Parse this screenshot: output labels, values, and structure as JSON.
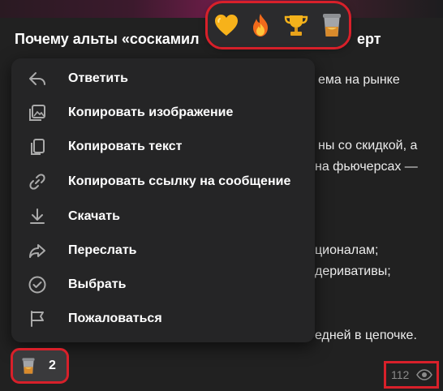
{
  "message": {
    "title_start": "Почему альты «соскамил",
    "title_end": "ерт",
    "lines": [
      "ема на рынке",
      "ны со скидкой, а",
      "на фьючерсах —",
      "ционалам;",
      "деривативы;",
      "едней в цепочке."
    ]
  },
  "reactions_bar": {
    "items": [
      {
        "name": "heart",
        "label": "💛"
      },
      {
        "name": "fire",
        "label": "🔥"
      },
      {
        "name": "trophy",
        "label": "🏆"
      },
      {
        "name": "trash",
        "label": "🗑"
      }
    ]
  },
  "context_menu": {
    "items": [
      {
        "label": "Ответить",
        "icon": "reply-icon"
      },
      {
        "label": "Копировать изображение",
        "icon": "copy-image-icon"
      },
      {
        "label": "Копировать текст",
        "icon": "copy-text-icon"
      },
      {
        "label": "Копировать ссылку на сообщение",
        "icon": "link-icon"
      },
      {
        "label": "Скачать",
        "icon": "download-icon"
      },
      {
        "label": "Переслать",
        "icon": "forward-icon"
      },
      {
        "label": "Выбрать",
        "icon": "select-icon"
      },
      {
        "label": "Пожаловаться",
        "icon": "flag-icon"
      }
    ]
  },
  "reaction_chip": {
    "icon": "trash-icon",
    "count": "2"
  },
  "views": {
    "count": "112",
    "icon": "eye-icon"
  },
  "colors": {
    "highlight": "#d8202a",
    "menu_bg": "#252526",
    "bubble_bg": "#212121"
  }
}
